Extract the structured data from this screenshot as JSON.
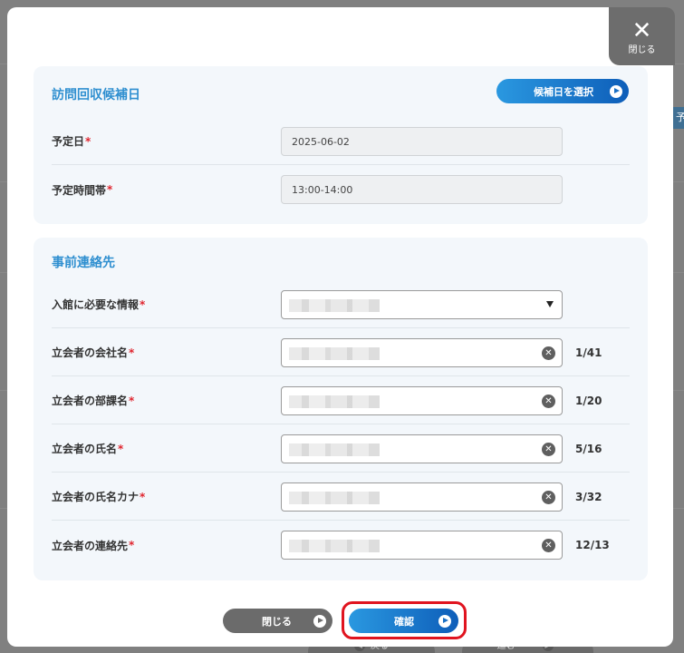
{
  "modal": {
    "close_x_label": "閉じる"
  },
  "visit": {
    "title": "訪問回収候補日",
    "select_button": "候補日を選択",
    "date_label": "予定日",
    "date_value": "2025-06-02",
    "time_label": "予定時間帯",
    "time_value": "13:00-14:00"
  },
  "contact": {
    "title": "事前連絡先",
    "fields": [
      {
        "label": "入館に必要な情報",
        "type": "select"
      },
      {
        "label": "立会者の会社名",
        "type": "text",
        "counter": "1/41"
      },
      {
        "label": "立会者の部課名",
        "type": "text",
        "counter": "1/20"
      },
      {
        "label": "立会者の氏名",
        "type": "text",
        "counter": "5/16"
      },
      {
        "label": "立会者の氏名カナ",
        "type": "text",
        "counter": "3/32"
      },
      {
        "label": "立会者の連絡先",
        "type": "text",
        "counter": "12/13"
      }
    ]
  },
  "required_mark": "*",
  "footer": {
    "close_button": "閉じる",
    "confirm_button": "確認"
  },
  "background": {
    "tab_glyph": "予",
    "back_button": "戻る",
    "next_button": "進む"
  },
  "colors": {
    "accent": "#2f8fd0",
    "primary_button": "#0e5eb9",
    "required": "#e0262f",
    "highlight_frame": "#e0141f"
  }
}
